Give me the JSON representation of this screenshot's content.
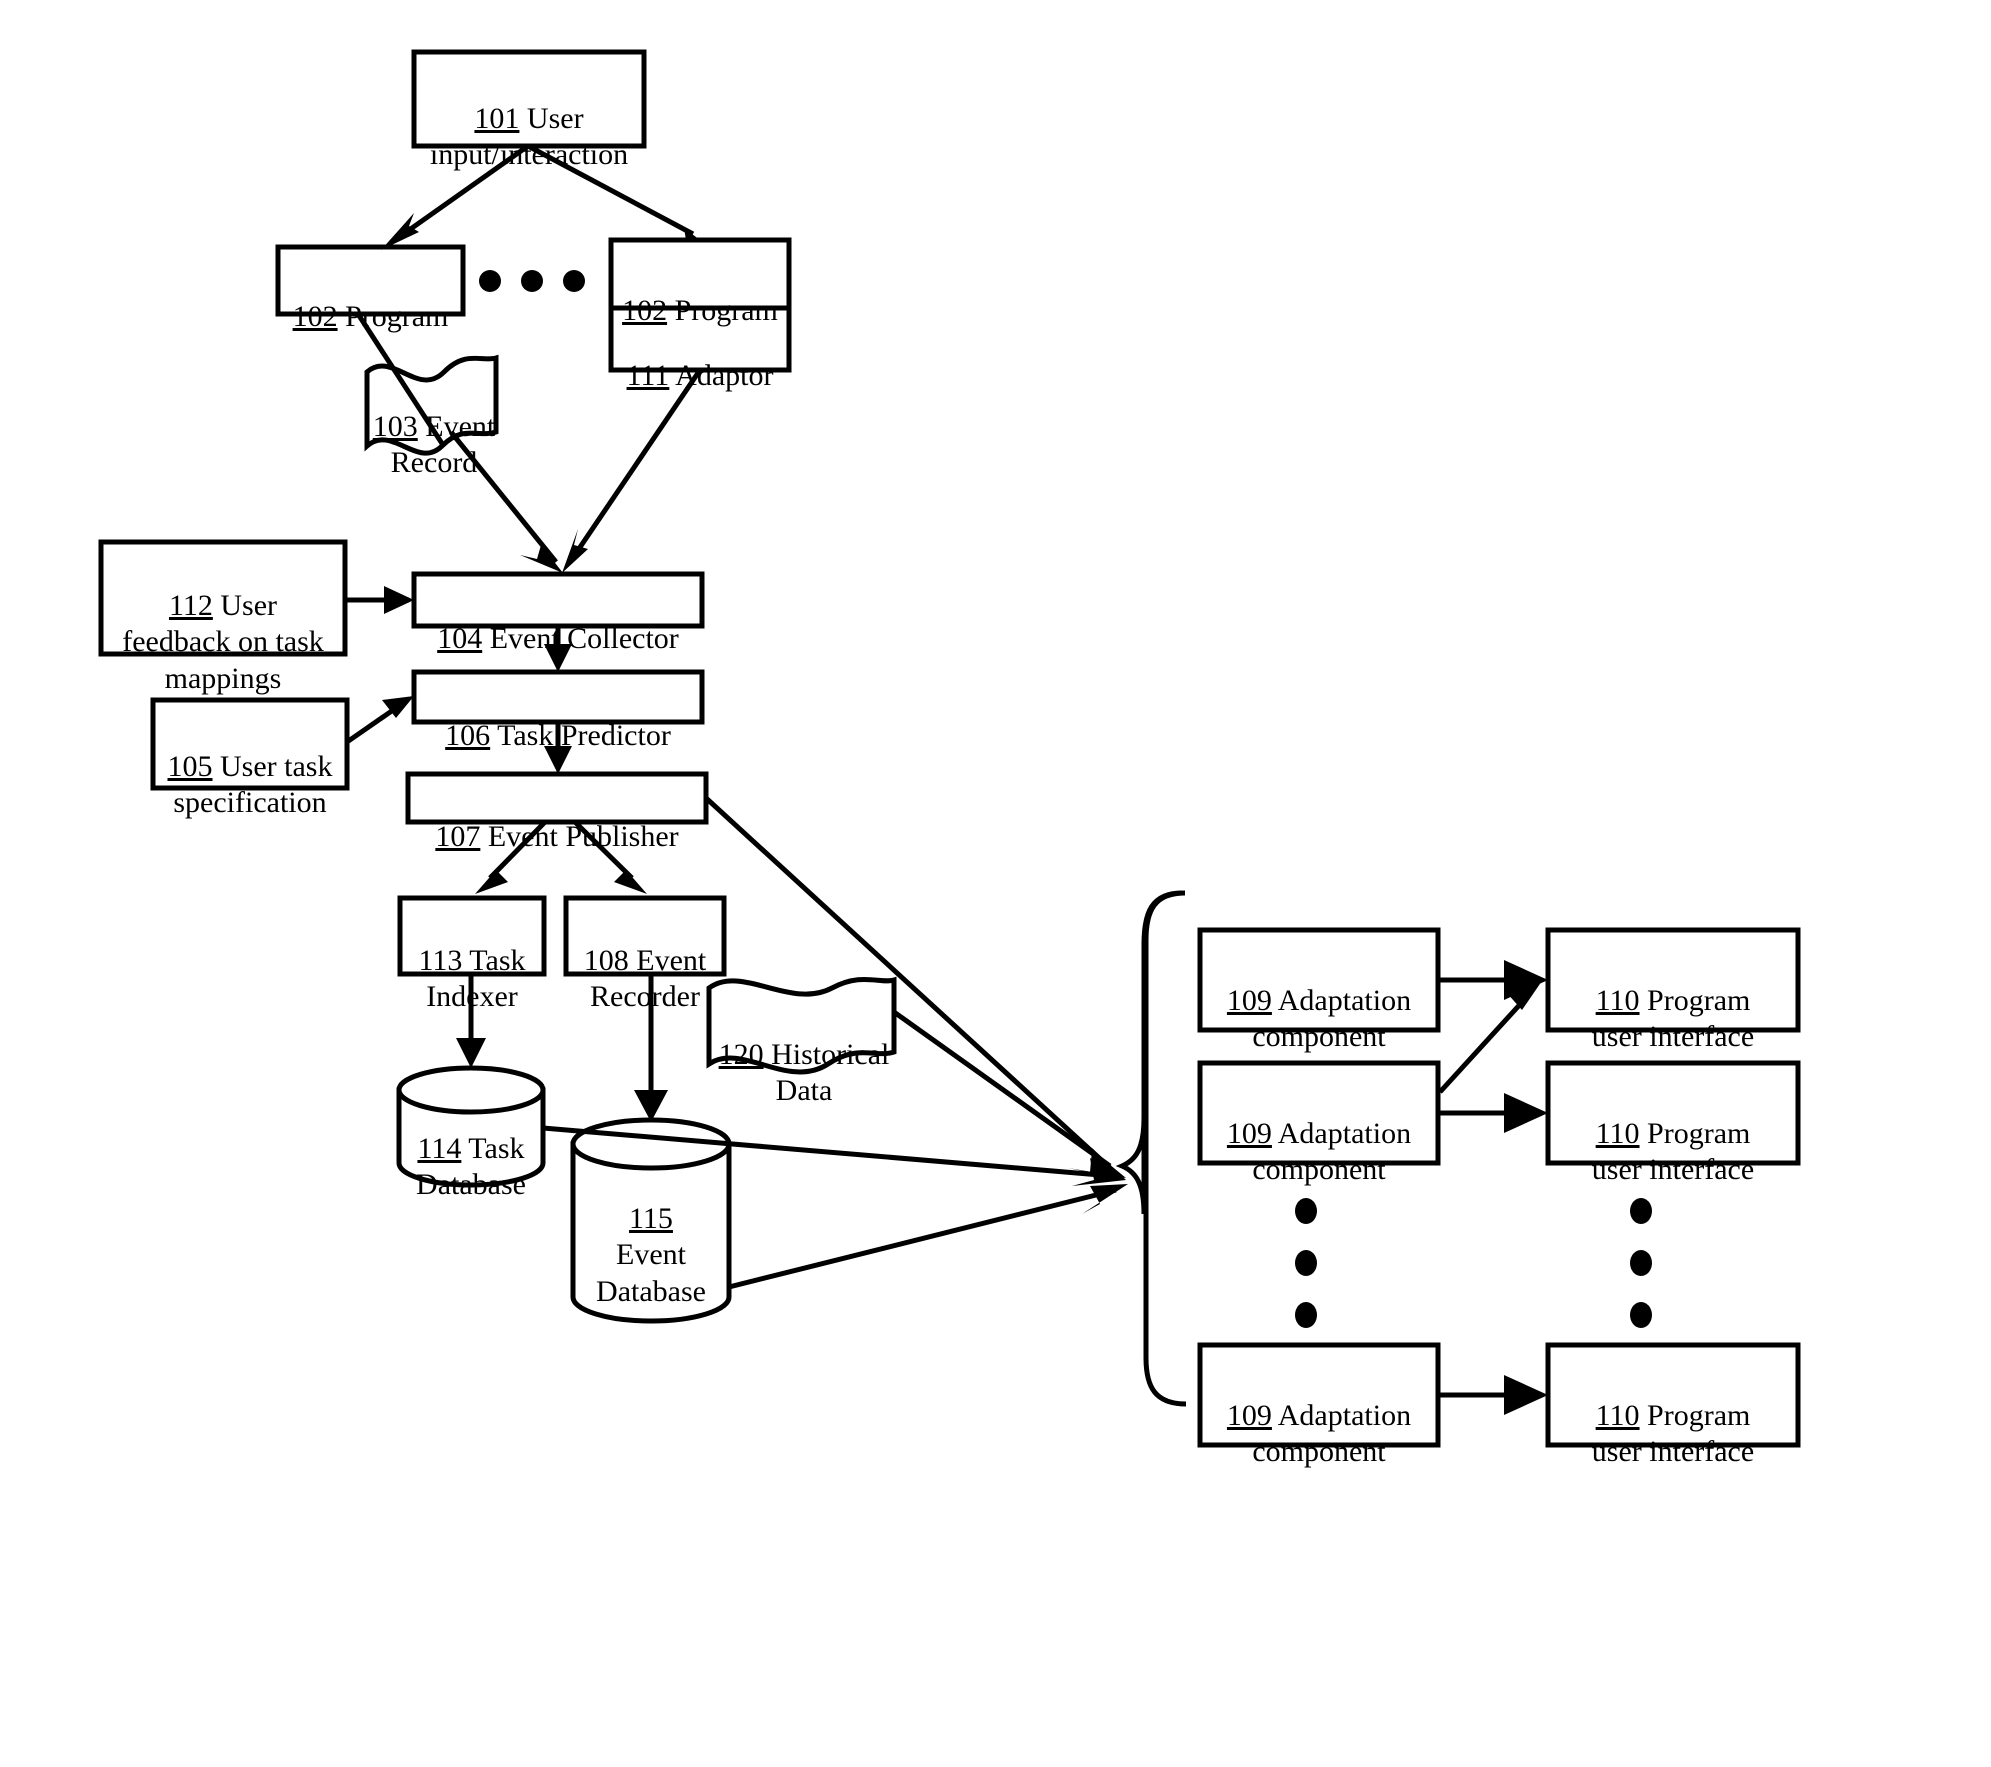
{
  "figure": {
    "type": "system-architecture-flowchart",
    "style": "patent-line-drawing",
    "stroke_color": "#000000",
    "background_color": "#ffffff"
  },
  "nodes": {
    "n101": {
      "num": "101",
      "text": " User\ninput/interaction",
      "shape": "rect"
    },
    "n102a": {
      "num": "102",
      "text": " Program",
      "shape": "rect"
    },
    "n102b": {
      "num": "102",
      "text": " Program",
      "shape": "rect"
    },
    "n111": {
      "num": "111",
      "text": " Adaptor",
      "shape": "rect"
    },
    "n103": {
      "num": "103",
      "text": " Event\nRecord",
      "shape": "flag"
    },
    "n112": {
      "num": "112",
      "text": " User\nfeedback on task\nmappings",
      "shape": "rect"
    },
    "n104": {
      "num": "104",
      "text": " Event Collector",
      "shape": "rect"
    },
    "n105": {
      "num": "105",
      "text": " User task\nspecification",
      "shape": "rect"
    },
    "n106": {
      "num": "106",
      "text": " Task Predictor",
      "shape": "rect"
    },
    "n107": {
      "num": "107",
      "text": " Event Publisher",
      "shape": "rect"
    },
    "n113": {
      "num": "113",
      "text": " Task\nIndexer",
      "shape": "rect"
    },
    "n108": {
      "num": "108",
      "text": " Event\nRecorder",
      "shape": "rect"
    },
    "n120": {
      "num": "120",
      "text": " Historical\nData",
      "shape": "flag"
    },
    "n114": {
      "num": "114",
      "text": " Task\nDatabase",
      "shape": "cylinder"
    },
    "n115": {
      "num": "115",
      "text": "\nEvent\nDatabase",
      "shape": "cylinder"
    },
    "n109a": {
      "num": "109",
      "text": " Adaptation\ncomponent",
      "shape": "rect"
    },
    "n109b": {
      "num": "109",
      "text": " Adaptation\ncomponent",
      "shape": "rect"
    },
    "n109c": {
      "num": "109",
      "text": " Adaptation\ncomponent",
      "shape": "rect"
    },
    "n110a": {
      "num": "110",
      "text": " Program\nuser interface",
      "shape": "rect"
    },
    "n110b": {
      "num": "110",
      "text": " Program\nuser interface",
      "shape": "rect"
    },
    "n110c": {
      "num": "110",
      "text": " Program\nuser interface",
      "shape": "rect"
    }
  },
  "ellipses": {
    "programs_row": {
      "count": 3,
      "orientation": "horizontal"
    },
    "adaptation_column": {
      "count": 3,
      "orientation": "vertical"
    },
    "interface_column": {
      "count": 3,
      "orientation": "vertical"
    }
  },
  "edges": [
    {
      "from": "n101",
      "to": "n102a",
      "arrow": true
    },
    {
      "from": "n101",
      "to": "n102b",
      "arrow": true
    },
    {
      "from": "n102a",
      "to": "n103",
      "arrow": false
    },
    {
      "from": "n103",
      "to": "n104",
      "arrow": true
    },
    {
      "from": "n111",
      "to": "n104",
      "arrow": true
    },
    {
      "from": "n112",
      "to": "n104",
      "arrow": true
    },
    {
      "from": "n104",
      "to": "n106",
      "arrow": true
    },
    {
      "from": "n105",
      "to": "n106",
      "arrow": true
    },
    {
      "from": "n106",
      "to": "n107",
      "arrow": true
    },
    {
      "from": "n107",
      "to": "n113",
      "arrow": true
    },
    {
      "from": "n107",
      "to": "n108",
      "arrow": true
    },
    {
      "from": "n107",
      "to": "adaptation-bracket",
      "arrow": true
    },
    {
      "from": "n113",
      "to": "n114",
      "arrow": true
    },
    {
      "from": "n108",
      "to": "n115",
      "arrow": true
    },
    {
      "from": "n114",
      "to": "adaptation-bracket",
      "arrow": true
    },
    {
      "from": "n115",
      "to": "adaptation-bracket",
      "arrow": true
    },
    {
      "from": "n120",
      "to": "adaptation-bracket",
      "arrow": true
    },
    {
      "from": "n109a",
      "to": "n110a",
      "arrow": true
    },
    {
      "from": "n109b",
      "to": "n110b",
      "arrow": true
    },
    {
      "from": "n109b",
      "to": "n110a",
      "arrow": true
    },
    {
      "from": "n109c",
      "to": "n110c",
      "arrow": true
    }
  ]
}
